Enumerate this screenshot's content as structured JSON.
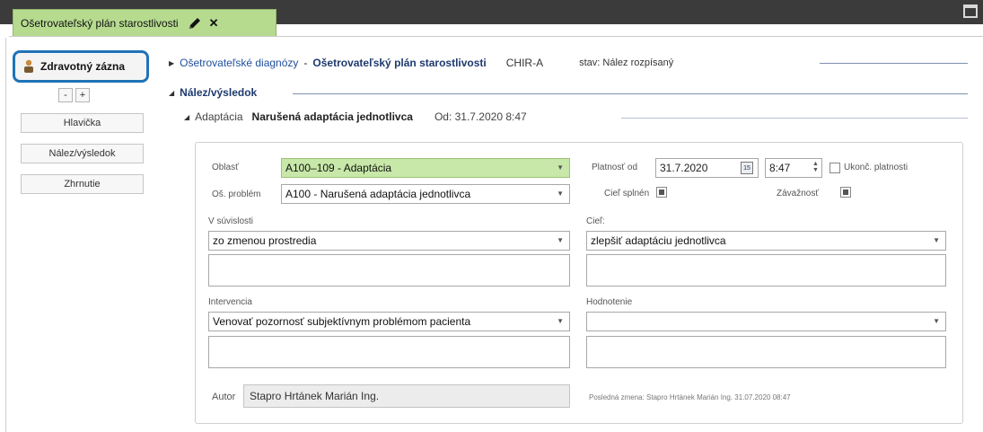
{
  "tab": {
    "title": "Ošetrovateľský plán starostlivosti",
    "edit_icon": "pencil-icon",
    "close_label": "✕"
  },
  "left": {
    "record_button": "Zdravotný zázna",
    "collapse_label": "-",
    "expand_label": "+",
    "buttons": [
      "Hlavička",
      "Nález/výsledok",
      "Zhrnutie"
    ]
  },
  "header": {
    "link": "Ošetrovateľské diagnózy",
    "separator": "-",
    "plan": "Ošetrovateľský plán starostlivosti",
    "dept": "CHIR-A",
    "status": "stav: Nález rozpísaný"
  },
  "section": {
    "title": "Nález/výsledok",
    "sub_label": "Adaptácia",
    "sub_name": "Narušená adaptácia jednotlivca",
    "sub_od": "Od: 31.7.2020 8:47"
  },
  "form": {
    "oblast_label": "Oblasť",
    "oblast_value": "A100–109 - Adaptácia",
    "problem_label": "Oš. problém",
    "problem_value": "A100 - Narušená adaptácia jednotlivca",
    "platnost_label": "Platnosť od",
    "platnost_date": "31.7.2020",
    "platnost_time": "8:47",
    "calendar_day": "15",
    "ukonc_label": "Ukonč. platnosti",
    "ciel_splnen_label": "Cieľ splnén",
    "zavaznost_label": "Závažnosť",
    "suvislost_label": "V súvislosti",
    "suvislost_value": "zo zmenou prostredia",
    "ciel_label": "Cieľ:",
    "ciel_value": "zlepšiť adaptáciu jednotlivca",
    "intervencia_label": "Intervencia",
    "intervencia_value": "Venovať pozornosť subjektívnym problémom pacienta",
    "hodnotenie_label": "Hodnotenie",
    "hodnotenie_value": "",
    "autor_label": "Autor",
    "autor_value": "Stapro Hrtánek Marián Ing.",
    "last_change": "Posledná zmena: Stapro Hrtánek Marián Ing. 31.07.2020 08:47"
  }
}
